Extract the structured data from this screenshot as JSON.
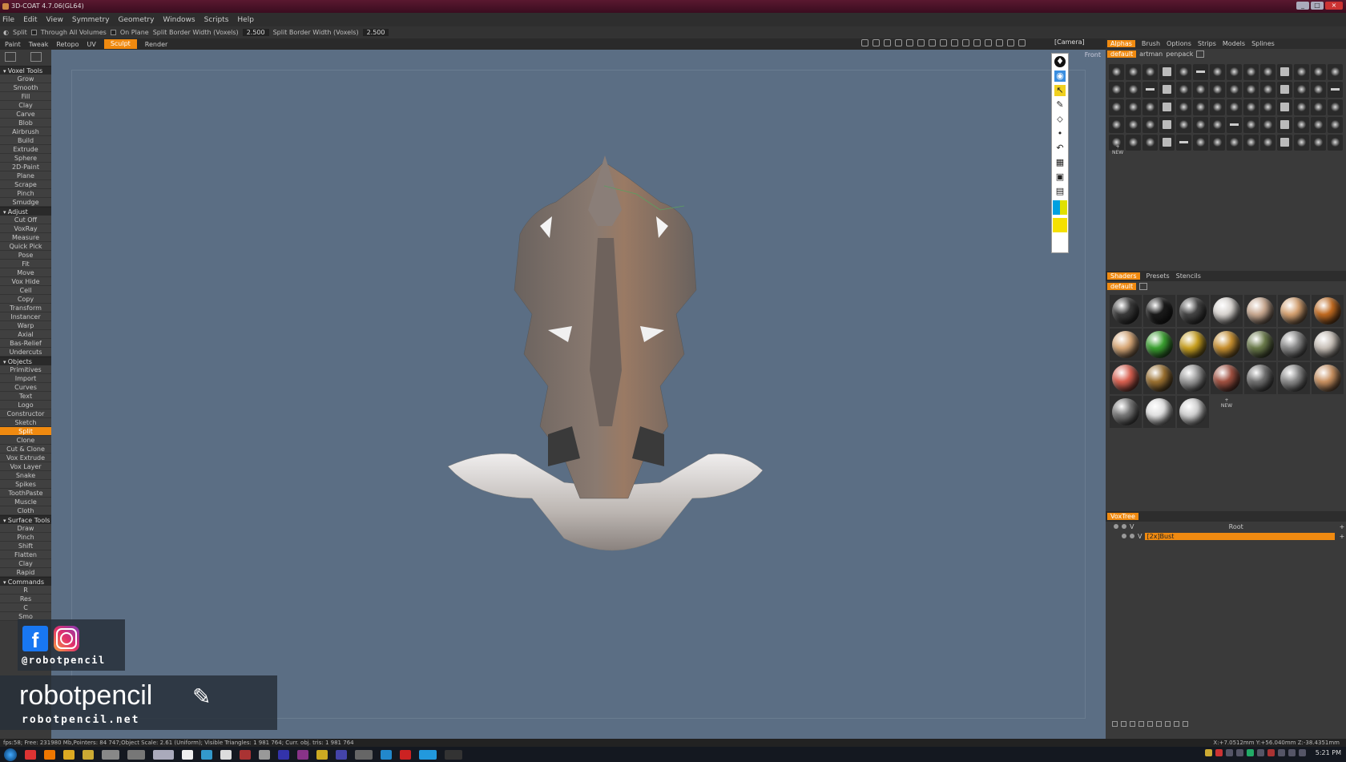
{
  "window": {
    "title": "3D-COAT 4.7.06(GL64)"
  },
  "menu": [
    "File",
    "Edit",
    "View",
    "Symmetry",
    "Geometry",
    "Windows",
    "Scripts",
    "Help"
  ],
  "tool_options": {
    "split_label": "Split",
    "through_label": "Through All Volumes",
    "onplane_label": "On Plane",
    "border1_label": "Split Border Width (Voxels)",
    "border1_value": "2.500",
    "border2_label": "Split Border Width (Voxels)",
    "border2_value": "2.500"
  },
  "rooms": [
    "Paint",
    "Tweak",
    "Retopo",
    "UV",
    "Sculpt",
    "Render"
  ],
  "rooms_active": "Sculpt",
  "camera_label": "[Camera]",
  "viewport": {
    "view_label": "Front"
  },
  "left_panel": {
    "sections": [
      {
        "title": "Voxel Tools",
        "items": [
          "Grow",
          "Smooth",
          "Fill",
          "Clay",
          "Carve",
          "Blob",
          "Airbrush",
          "Build",
          "Extrude",
          "Sphere",
          "2D-Paint",
          "Plane",
          "Scrape",
          "Pinch",
          "Smudge"
        ]
      },
      {
        "title": "Adjust",
        "items": [
          "Cut Off",
          "VoxRay",
          "Measure",
          "Quick Pick",
          "Pose",
          "Fit",
          "Move",
          "Vox Hide",
          "Cell",
          "Copy",
          "Transform",
          "Instancer",
          "Warp",
          "Axial",
          "Bas-Relief",
          "Undercuts"
        ]
      },
      {
        "title": "Objects",
        "items": [
          "Primitives",
          "Import",
          "Curves",
          "Text",
          "Logo",
          "Constructor",
          "Sketch",
          "Split",
          "Clone",
          "Cut & Clone",
          "Vox Extrude",
          "Vox Layer",
          "Snake",
          "Spikes",
          "ToothPaste",
          "Muscle",
          "Cloth"
        ]
      },
      {
        "title": "Surface Tools",
        "items": [
          "Draw",
          "Pinch",
          "Shift",
          "Flatten",
          "Clay",
          "Rapid"
        ]
      },
      {
        "title": "Commands",
        "items": [
          "R",
          "Res",
          "C",
          "Smo"
        ]
      }
    ],
    "active_item": "Split"
  },
  "alphas_panel": {
    "tabs": [
      "Alphas",
      "Brush",
      "Options",
      "Strips",
      "Models",
      "Splines"
    ],
    "active_tab": "Alphas",
    "sets": [
      "default",
      "artman",
      "penpack"
    ],
    "active_set": "default",
    "new_label": "NEW"
  },
  "shaders_panel": {
    "tabs": [
      "Shaders",
      "Presets",
      "Stencils"
    ],
    "active_tab": "Shaders",
    "set": "default",
    "new_label": "NEW",
    "colors": [
      "#3a3a3a",
      "#1a1a1a",
      "#444444",
      "#d8d4d0",
      "#c8a890",
      "#d4a070",
      "#c06a20",
      "#d8a878",
      "#3aa030",
      "#c8a020",
      "#c89030",
      "#6a7a4a",
      "#8a8a8a",
      "#c8c0b8",
      "#d86050",
      "#9a7030",
      "#9a9a9a",
      "#a05040",
      "#707070",
      "#8a8a8a",
      "#c89060",
      "#777777",
      "#e0e0e0",
      "#d0d0d0"
    ]
  },
  "voxtree": {
    "title": "VoxTree",
    "rows": [
      {
        "vis": "V",
        "name": "Root"
      },
      {
        "vis": "V",
        "name": "[2x]Bust"
      }
    ]
  },
  "statusbar": {
    "text": "fps:58;   Free: 231980 Mb,Pointers: 84 747;Object Scale: 2.61 (Uniform); Visible Triangles: 1 981 764; Curr. obj. tris: 1 981 764",
    "coords": "X:+7.0512mm  Y:+56.040mm  Z:-38.4351mm"
  },
  "taskbar": {
    "time": "5:21 PM"
  },
  "overlay": {
    "handle": "@robotpencil",
    "brand": "robotpencil",
    "url": "robotpencil.net"
  },
  "colors": {
    "accent": "#f08a10",
    "viewport_bg": "#5b6e84"
  }
}
